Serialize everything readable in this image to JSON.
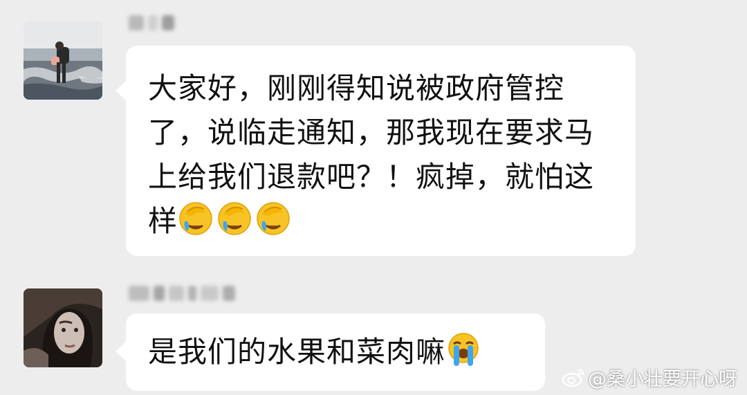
{
  "messages": [
    {
      "avatar": "seaside-traveler-photo",
      "text": "大家好，刚刚得知说被政府管控了，说临走通知，那我现在要求马上给我们退款吧？！疯掉，就怕这样",
      "emojis": [
        "facepalm-crying-emoji",
        "facepalm-crying-emoji",
        "facepalm-crying-emoji"
      ]
    },
    {
      "avatar": "woman-portrait-photo",
      "text": "是我们的水果和菜肉嘛",
      "emojis": [
        "loudly-crying-emoji"
      ]
    }
  ],
  "watermark": {
    "icon": "weibo-logo-icon",
    "text": "@桑小壮要开心呀"
  },
  "colors": {
    "background": "#ededed",
    "bubble": "#ffffff",
    "text": "#111111",
    "emoji_face": "#f7c325"
  }
}
